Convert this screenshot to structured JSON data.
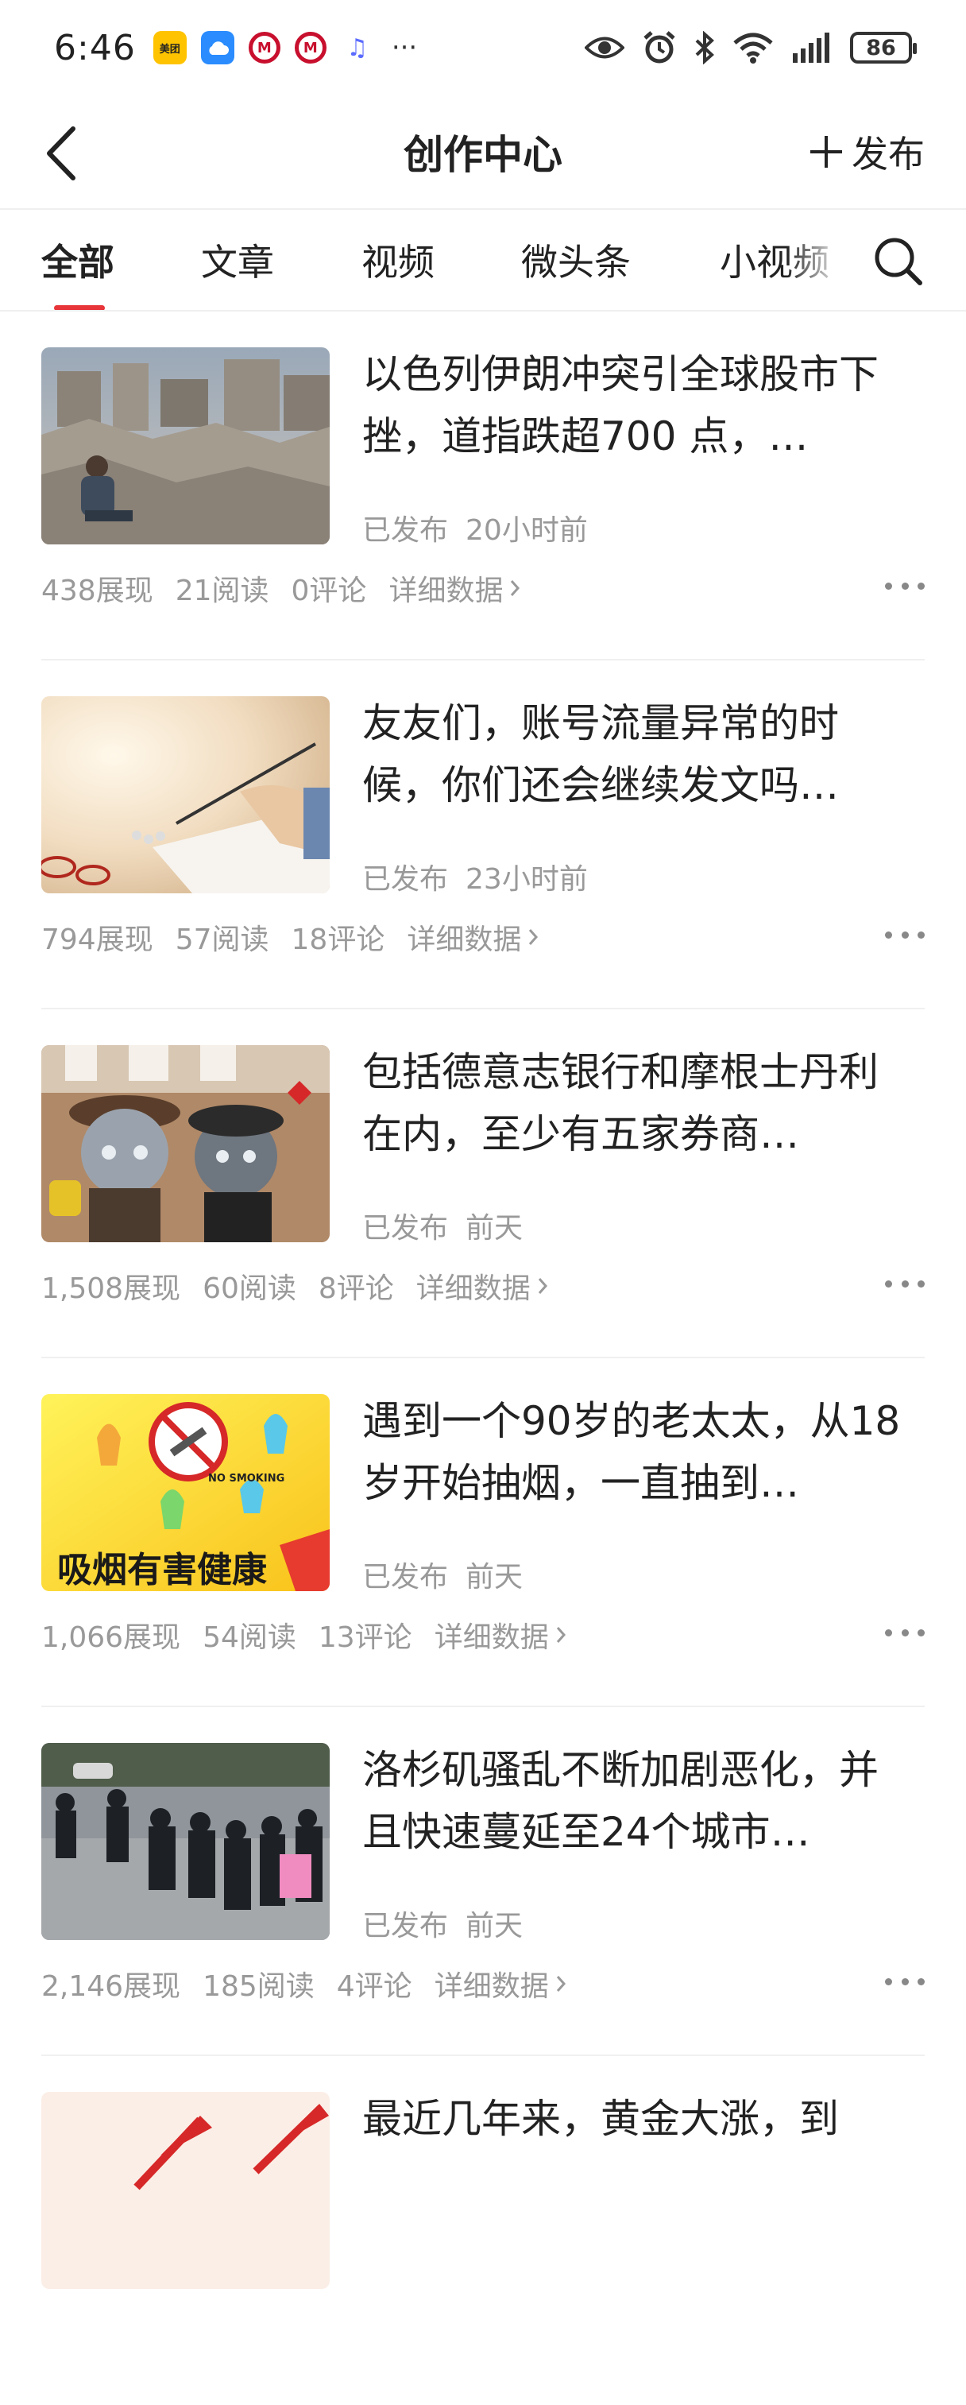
{
  "status_bar": {
    "time": "6:46",
    "apps": [
      {
        "icon": "meituan-app-icon",
        "label": "美团"
      },
      {
        "icon": "cloud-app-icon",
        "label": ""
      },
      {
        "icon": "metro-app-icon",
        "label": "M"
      },
      {
        "icon": "metro-app-icon",
        "label": "M"
      },
      {
        "icon": "music-app-icon",
        "label": "♫"
      }
    ],
    "more": "···",
    "battery": "86"
  },
  "navbar": {
    "title": "创作中心",
    "publish_label": "发布"
  },
  "tabs": [
    {
      "label": "全部",
      "active": true
    },
    {
      "label": "文章",
      "active": false
    },
    {
      "label": "视频",
      "active": false
    },
    {
      "label": "微头条",
      "active": false
    },
    {
      "label": "小视频",
      "active": false
    }
  ],
  "articles": [
    {
      "title": "以色列伊朗冲突引全球股市下挫，道指跌超700 点，…",
      "status": "已发布",
      "time": "20小时前",
      "impressions": "438展现",
      "reads": "21阅读",
      "comments": "0评论",
      "detail": "详细数据"
    },
    {
      "title": "友友们，账号流量异常的时候，你们还会继续发文吗…",
      "status": "已发布",
      "time": "23小时前",
      "impressions": "794展现",
      "reads": "57阅读",
      "comments": "18评论",
      "detail": "详细数据"
    },
    {
      "title": "包括德意志银行和摩根士丹利在内，至少有五家券商…",
      "status": "已发布",
      "time": "前天",
      "impressions": "1,508展现",
      "reads": "60阅读",
      "comments": "8评论",
      "detail": "详细数据"
    },
    {
      "title": "遇到一个90岁的老太太，从18岁开始抽烟，一直抽到…",
      "status": "已发布",
      "time": "前天",
      "impressions": "1,066展现",
      "reads": "54阅读",
      "comments": "13评论",
      "detail": "详细数据",
      "thumb_text": "吸烟有害健康",
      "thumb_small_text": "NO SMOKING"
    },
    {
      "title": "洛杉矶骚乱不断加剧恶化，并且快速蔓延至24个城市…",
      "status": "已发布",
      "time": "前天",
      "impressions": "2,146展现",
      "reads": "185阅读",
      "comments": "4评论",
      "detail": "详细数据"
    },
    {
      "title": "最近几年来，黄金大涨，到"
    }
  ],
  "colors": {
    "accent": "#e8353a",
    "text": "#222222",
    "muted": "#999999"
  }
}
